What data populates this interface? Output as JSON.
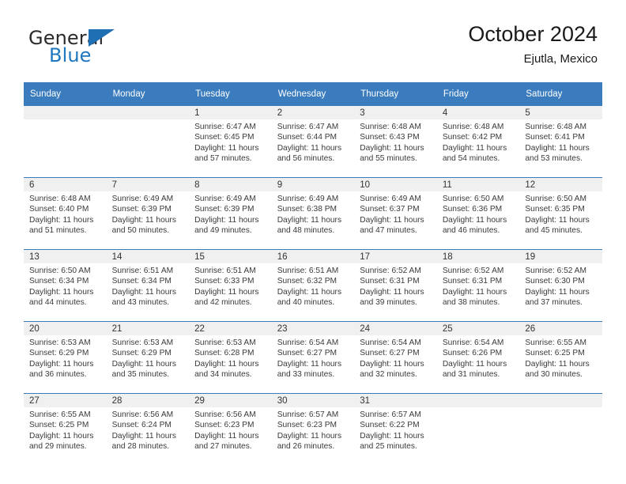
{
  "brand": {
    "word_one": "General",
    "word_two": "Blue",
    "flag_icon": "blue-triangle-flag-icon"
  },
  "header": {
    "title": "October 2024",
    "subtitle": "Ejutla, Mexico"
  },
  "calendar": {
    "weekday_headers": [
      "Sunday",
      "Monday",
      "Tuesday",
      "Wednesday",
      "Thursday",
      "Friday",
      "Saturday"
    ],
    "colors": {
      "header_blue": "#3a7cbe",
      "daynum_band": "#f0f0f0",
      "brand_blue": "#1f77bf",
      "text": "#3a3a3a"
    },
    "weeks": [
      [
        {
          "day": "",
          "lines": []
        },
        {
          "day": "",
          "lines": []
        },
        {
          "day": "1",
          "lines": [
            "Sunrise: 6:47 AM",
            "Sunset: 6:45 PM",
            "Daylight: 11 hours",
            "and 57 minutes."
          ]
        },
        {
          "day": "2",
          "lines": [
            "Sunrise: 6:47 AM",
            "Sunset: 6:44 PM",
            "Daylight: 11 hours",
            "and 56 minutes."
          ]
        },
        {
          "day": "3",
          "lines": [
            "Sunrise: 6:48 AM",
            "Sunset: 6:43 PM",
            "Daylight: 11 hours",
            "and 55 minutes."
          ]
        },
        {
          "day": "4",
          "lines": [
            "Sunrise: 6:48 AM",
            "Sunset: 6:42 PM",
            "Daylight: 11 hours",
            "and 54 minutes."
          ]
        },
        {
          "day": "5",
          "lines": [
            "Sunrise: 6:48 AM",
            "Sunset: 6:41 PM",
            "Daylight: 11 hours",
            "and 53 minutes."
          ]
        }
      ],
      [
        {
          "day": "6",
          "lines": [
            "Sunrise: 6:48 AM",
            "Sunset: 6:40 PM",
            "Daylight: 11 hours",
            "and 51 minutes."
          ]
        },
        {
          "day": "7",
          "lines": [
            "Sunrise: 6:49 AM",
            "Sunset: 6:39 PM",
            "Daylight: 11 hours",
            "and 50 minutes."
          ]
        },
        {
          "day": "8",
          "lines": [
            "Sunrise: 6:49 AM",
            "Sunset: 6:39 PM",
            "Daylight: 11 hours",
            "and 49 minutes."
          ]
        },
        {
          "day": "9",
          "lines": [
            "Sunrise: 6:49 AM",
            "Sunset: 6:38 PM",
            "Daylight: 11 hours",
            "and 48 minutes."
          ]
        },
        {
          "day": "10",
          "lines": [
            "Sunrise: 6:49 AM",
            "Sunset: 6:37 PM",
            "Daylight: 11 hours",
            "and 47 minutes."
          ]
        },
        {
          "day": "11",
          "lines": [
            "Sunrise: 6:50 AM",
            "Sunset: 6:36 PM",
            "Daylight: 11 hours",
            "and 46 minutes."
          ]
        },
        {
          "day": "12",
          "lines": [
            "Sunrise: 6:50 AM",
            "Sunset: 6:35 PM",
            "Daylight: 11 hours",
            "and 45 minutes."
          ]
        }
      ],
      [
        {
          "day": "13",
          "lines": [
            "Sunrise: 6:50 AM",
            "Sunset: 6:34 PM",
            "Daylight: 11 hours",
            "and 44 minutes."
          ]
        },
        {
          "day": "14",
          "lines": [
            "Sunrise: 6:51 AM",
            "Sunset: 6:34 PM",
            "Daylight: 11 hours",
            "and 43 minutes."
          ]
        },
        {
          "day": "15",
          "lines": [
            "Sunrise: 6:51 AM",
            "Sunset: 6:33 PM",
            "Daylight: 11 hours",
            "and 42 minutes."
          ]
        },
        {
          "day": "16",
          "lines": [
            "Sunrise: 6:51 AM",
            "Sunset: 6:32 PM",
            "Daylight: 11 hours",
            "and 40 minutes."
          ]
        },
        {
          "day": "17",
          "lines": [
            "Sunrise: 6:52 AM",
            "Sunset: 6:31 PM",
            "Daylight: 11 hours",
            "and 39 minutes."
          ]
        },
        {
          "day": "18",
          "lines": [
            "Sunrise: 6:52 AM",
            "Sunset: 6:31 PM",
            "Daylight: 11 hours",
            "and 38 minutes."
          ]
        },
        {
          "day": "19",
          "lines": [
            "Sunrise: 6:52 AM",
            "Sunset: 6:30 PM",
            "Daylight: 11 hours",
            "and 37 minutes."
          ]
        }
      ],
      [
        {
          "day": "20",
          "lines": [
            "Sunrise: 6:53 AM",
            "Sunset: 6:29 PM",
            "Daylight: 11 hours",
            "and 36 minutes."
          ]
        },
        {
          "day": "21",
          "lines": [
            "Sunrise: 6:53 AM",
            "Sunset: 6:29 PM",
            "Daylight: 11 hours",
            "and 35 minutes."
          ]
        },
        {
          "day": "22",
          "lines": [
            "Sunrise: 6:53 AM",
            "Sunset: 6:28 PM",
            "Daylight: 11 hours",
            "and 34 minutes."
          ]
        },
        {
          "day": "23",
          "lines": [
            "Sunrise: 6:54 AM",
            "Sunset: 6:27 PM",
            "Daylight: 11 hours",
            "and 33 minutes."
          ]
        },
        {
          "day": "24",
          "lines": [
            "Sunrise: 6:54 AM",
            "Sunset: 6:27 PM",
            "Daylight: 11 hours",
            "and 32 minutes."
          ]
        },
        {
          "day": "25",
          "lines": [
            "Sunrise: 6:54 AM",
            "Sunset: 6:26 PM",
            "Daylight: 11 hours",
            "and 31 minutes."
          ]
        },
        {
          "day": "26",
          "lines": [
            "Sunrise: 6:55 AM",
            "Sunset: 6:25 PM",
            "Daylight: 11 hours",
            "and 30 minutes."
          ]
        }
      ],
      [
        {
          "day": "27",
          "lines": [
            "Sunrise: 6:55 AM",
            "Sunset: 6:25 PM",
            "Daylight: 11 hours",
            "and 29 minutes."
          ]
        },
        {
          "day": "28",
          "lines": [
            "Sunrise: 6:56 AM",
            "Sunset: 6:24 PM",
            "Daylight: 11 hours",
            "and 28 minutes."
          ]
        },
        {
          "day": "29",
          "lines": [
            "Sunrise: 6:56 AM",
            "Sunset: 6:23 PM",
            "Daylight: 11 hours",
            "and 27 minutes."
          ]
        },
        {
          "day": "30",
          "lines": [
            "Sunrise: 6:57 AM",
            "Sunset: 6:23 PM",
            "Daylight: 11 hours",
            "and 26 minutes."
          ]
        },
        {
          "day": "31",
          "lines": [
            "Sunrise: 6:57 AM",
            "Sunset: 6:22 PM",
            "Daylight: 11 hours",
            "and 25 minutes."
          ]
        },
        {
          "day": "",
          "lines": []
        },
        {
          "day": "",
          "lines": []
        }
      ]
    ]
  }
}
